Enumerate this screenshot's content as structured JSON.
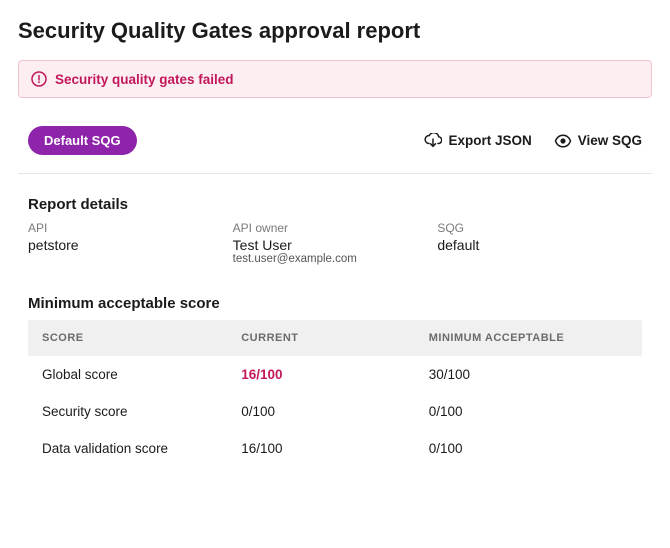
{
  "page": {
    "title": "Security Quality Gates approval report"
  },
  "alert": {
    "message": "Security quality gates failed"
  },
  "toolbar": {
    "pill_label": "Default SQG",
    "export_label": "Export JSON",
    "view_label": "View SQG"
  },
  "details": {
    "heading": "Report details",
    "api_label": "API",
    "api_value": "petstore",
    "owner_label": "API owner",
    "owner_value": "Test User",
    "owner_email": "test.user@example.com",
    "sqg_label": "SQG",
    "sqg_value": "default"
  },
  "scores": {
    "heading": "Minimum acceptable score",
    "header": {
      "score": "SCORE",
      "current": "CURRENT",
      "minimum": "MINIMUM ACCEPTABLE"
    },
    "rows": [
      {
        "label": "Global score",
        "current": "16/100",
        "minimum": "30/100",
        "fail": true
      },
      {
        "label": "Security score",
        "current": "0/100",
        "minimum": "0/100",
        "fail": false
      },
      {
        "label": "Data validation score",
        "current": "16/100",
        "minimum": "0/100",
        "fail": false
      }
    ]
  }
}
